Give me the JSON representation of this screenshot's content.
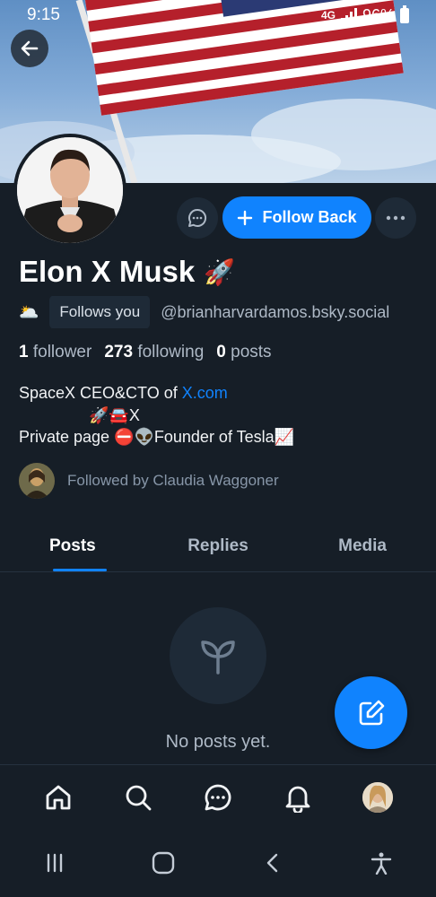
{
  "status_bar": {
    "time": "9:15",
    "network": "4G",
    "battery": "96%"
  },
  "profile": {
    "display_name": "Elon X Musk",
    "name_emoji": "🚀",
    "mood_emoji": "🌥️",
    "follows_you": "Follows you",
    "handle": "@brianharvardamos.bsky.social",
    "stats": {
      "followers_count": "1",
      "followers_label": "follower",
      "following_count": "273",
      "following_label": "following",
      "posts_count": "0",
      "posts_label": "posts"
    },
    "bio": {
      "line1_prefix": "SpaceX CEO&CTO of ",
      "line1_link": "X.com",
      "line2": "🚀🚘X",
      "line3": "Private page ⛔👽Founder of Tesla📈"
    },
    "followed_by": "Followed by Claudia Waggoner"
  },
  "actions": {
    "follow_back": "Follow Back"
  },
  "tabs": [
    {
      "label": "Posts",
      "active": true
    },
    {
      "label": "Replies",
      "active": false
    },
    {
      "label": "Media",
      "active": false
    }
  ],
  "empty_state": {
    "message": "No posts yet."
  },
  "colors": {
    "background": "#161e27",
    "accent": "#1083fe",
    "surface": "#1e2a37",
    "muted_text": "#aeb9c6"
  },
  "bottom_nav": [
    {
      "icon": "home-icon"
    },
    {
      "icon": "search-icon"
    },
    {
      "icon": "chat-icon"
    },
    {
      "icon": "bell-icon"
    },
    {
      "icon": "profile-avatar"
    }
  ]
}
